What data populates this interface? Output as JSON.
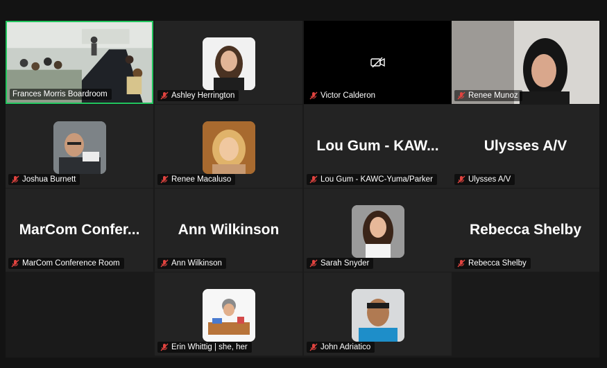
{
  "participants": [
    {
      "name": "Frances Morris Boardroom",
      "type": "video-room",
      "active": true
    },
    {
      "name": "Ashley Herrington",
      "type": "avatar"
    },
    {
      "name": "Victor Calderon",
      "type": "camera-off"
    },
    {
      "name": "Renee Munoz",
      "type": "video-person"
    },
    {
      "name": "Joshua Burnett",
      "type": "avatar"
    },
    {
      "name": "Renee Macaluso",
      "type": "avatar"
    },
    {
      "name": "Lou Gum - KAWC-Yuma/Parker",
      "display": "Lou Gum  -  KAW...",
      "type": "name-only"
    },
    {
      "name": "Ulysses A/V",
      "display": "Ulysses A/V",
      "type": "name-only"
    },
    {
      "name": "MarCom Conference Room",
      "display": "MarCom  Confer...",
      "type": "name-only"
    },
    {
      "name": "Ann Wilkinson",
      "display": "Ann Wilkinson",
      "type": "name-only"
    },
    {
      "name": "Sarah Snyder",
      "type": "avatar"
    },
    {
      "name": "Rebecca Shelby",
      "display": "Rebecca Shelby",
      "type": "name-only"
    },
    {
      "name": "Erin Whittig | she, her",
      "type": "avatar"
    },
    {
      "name": "John Adriatico",
      "type": "avatar"
    }
  ],
  "colors": {
    "active_border": "#22c55e",
    "muted_mic": "#e0433f",
    "tile_bg": "#232323"
  },
  "icons": {
    "muted": "muted-mic-icon",
    "camera_off": "camera-off-icon"
  }
}
